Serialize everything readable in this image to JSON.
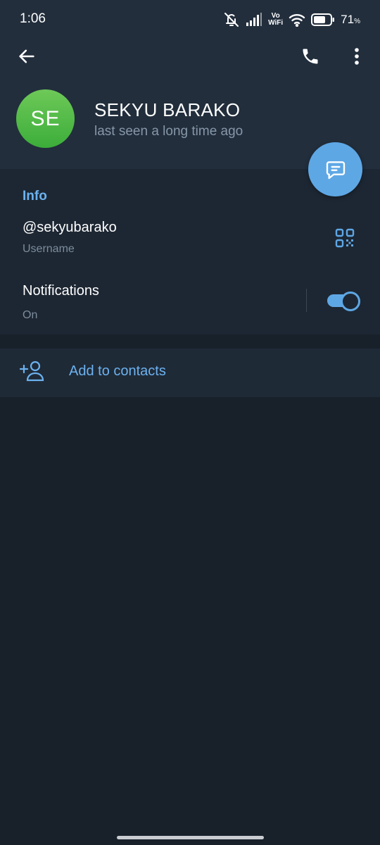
{
  "status_bar": {
    "time": "1:06",
    "vowifi_top": "Vo",
    "vowifi_bottom": "WiFi",
    "battery_percent": "71",
    "battery_unit": "%"
  },
  "toolbar": {
    "back_icon": "arrow-left-icon",
    "call_icon": "phone-icon",
    "menu_icon": "more-vertical-icon"
  },
  "profile": {
    "avatar_initials": "SE",
    "name": "SEKYU BARAKO",
    "last_seen": "last seen a long time ago"
  },
  "fab": {
    "icon": "chat-message-icon"
  },
  "info": {
    "heading": "Info",
    "username": "@sekyubarako",
    "username_label": "Username",
    "qr_icon": "qr-code-icon",
    "notifications_title": "Notifications",
    "notifications_status": "On",
    "notifications_enabled": true
  },
  "actions": {
    "add_to_contacts": "Add to contacts",
    "add_contact_icon": "add-person-icon"
  },
  "colors": {
    "accent": "#5ea7e5",
    "link_text": "#6cb2ef",
    "header_bg": "#222e3c",
    "page_bg": "#18202a",
    "avatar_green": "#4cb944"
  }
}
